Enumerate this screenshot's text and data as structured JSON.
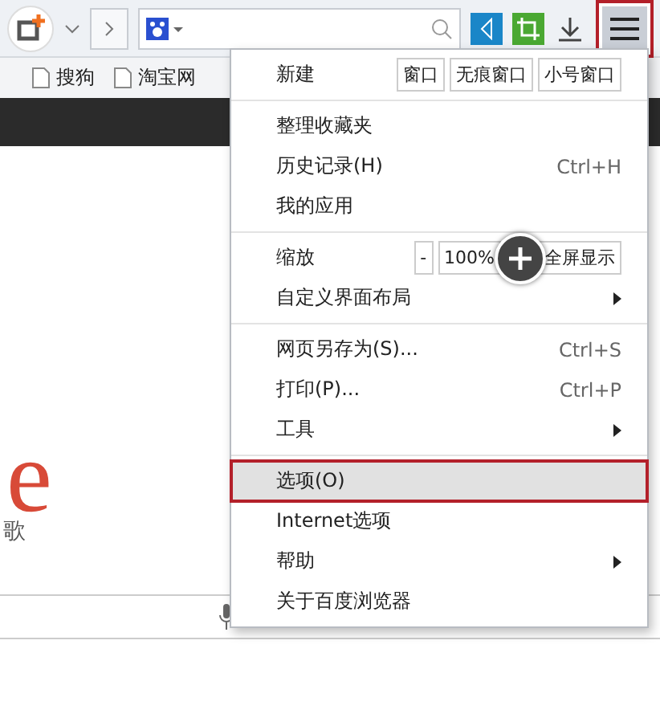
{
  "toolbar": {
    "menu_button_highlighted": true
  },
  "bookmarks": [
    "搜狗",
    "淘宝网"
  ],
  "page": {
    "logo_letter": "e",
    "logo_caption": "歌"
  },
  "menu": {
    "sections": [
      {
        "items": [
          {
            "kind": "new",
            "label": "新建",
            "buttons": [
              "窗口",
              "无痕窗口",
              "小号窗口"
            ]
          }
        ]
      },
      {
        "items": [
          {
            "kind": "item",
            "label": "整理收藏夹",
            "selected": false,
            "submenu": false
          },
          {
            "kind": "item",
            "label": "历史记录(H)",
            "shortcut": "Ctrl+H",
            "selected": false,
            "submenu": false
          },
          {
            "kind": "item",
            "label": "我的应用",
            "selected": false,
            "submenu": false
          }
        ]
      },
      {
        "items": [
          {
            "kind": "zoom",
            "label": "缩放",
            "minus": "-",
            "value": "100%",
            "fullscreen": "全屏显示"
          },
          {
            "kind": "item",
            "label": "自定义界面布局",
            "selected": false,
            "submenu": true
          }
        ]
      },
      {
        "items": [
          {
            "kind": "item",
            "label": "网页另存为(S)...",
            "shortcut": "Ctrl+S",
            "selected": false,
            "submenu": false
          },
          {
            "kind": "item",
            "label": "打印(P)...",
            "shortcut": "Ctrl+P",
            "selected": false,
            "submenu": false
          },
          {
            "kind": "item",
            "label": "工具",
            "selected": false,
            "submenu": true
          }
        ]
      },
      {
        "items": [
          {
            "kind": "item",
            "label": "选项(O)",
            "selected": true,
            "submenu": false
          },
          {
            "kind": "item",
            "label": "Internet选项",
            "selected": false,
            "submenu": false
          },
          {
            "kind": "item",
            "label": "帮助",
            "selected": false,
            "submenu": true
          },
          {
            "kind": "item",
            "label": "关于百度浏览器",
            "selected": false,
            "submenu": false
          }
        ]
      }
    ]
  }
}
